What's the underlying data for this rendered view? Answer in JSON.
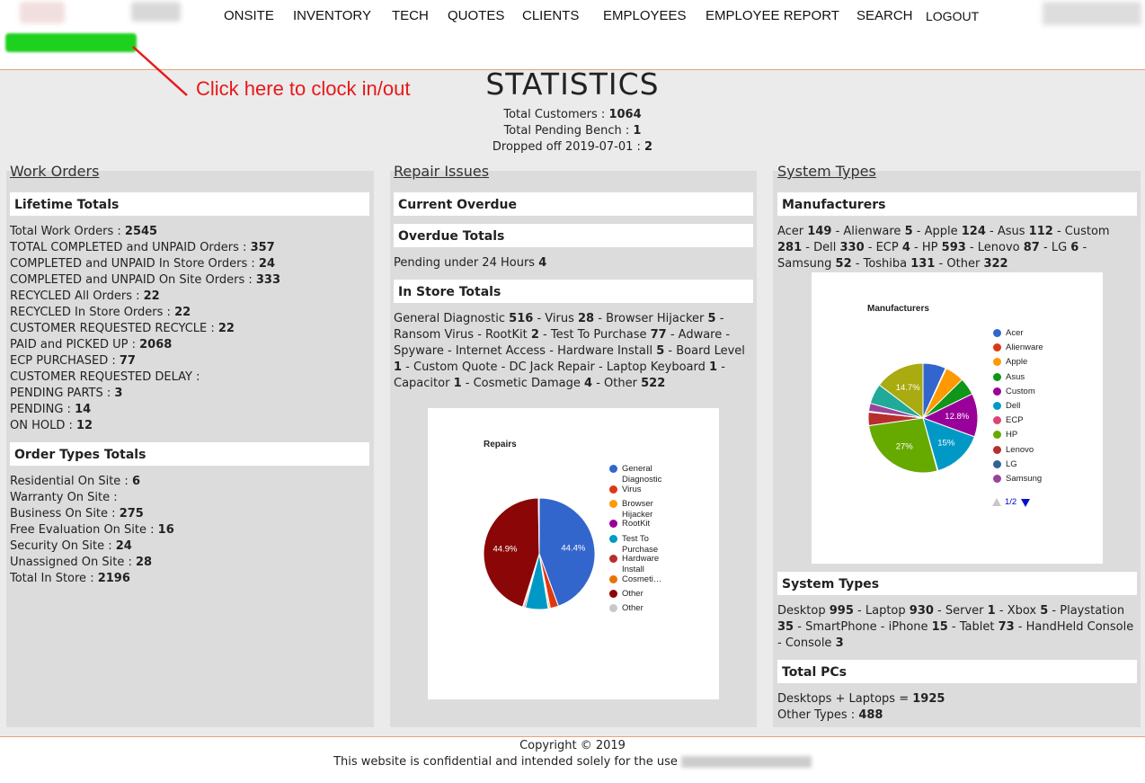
{
  "nav": {
    "items": [
      "ONSITE",
      "INVENTORY",
      "TECH",
      "QUOTES",
      "CLIENTS",
      "EMPLOYEES",
      "EMPLOYEE REPORT",
      "SEARCH",
      "LOGOUT"
    ]
  },
  "annotation": {
    "text": "Click here to clock in/out",
    "color": "#e8181b"
  },
  "stats": {
    "title": "STATISTICS",
    "total_customers_label": "Total Customers :",
    "total_customers": "1064",
    "pending_bench_label": "Total Pending Bench :",
    "pending_bench": "1",
    "dropped_off_label": "Dropped off 2019-07-01 :",
    "dropped_off": "2"
  },
  "work_orders": {
    "title": "Work Orders",
    "lifetime_title": "Lifetime Totals",
    "lifetime": [
      {
        "label": "Total Work Orders :",
        "value": "2545"
      },
      {
        "label": "TOTAL COMPLETED and UNPAID Orders :",
        "value": "357"
      },
      {
        "label": "COMPLETED and UNPAID In Store Orders :",
        "value": "24"
      },
      {
        "label": "COMPLETED and UNPAID On Site Orders :",
        "value": "333"
      },
      {
        "label": "RECYCLED All Orders :",
        "value": "22"
      },
      {
        "label": "RECYCLED In Store Orders :",
        "value": "22"
      },
      {
        "label": "CUSTOMER REQUESTED RECYCLE :",
        "value": "22"
      },
      {
        "label": "PAID and PICKED UP :",
        "value": "2068"
      },
      {
        "label": "ECP PURCHASED :",
        "value": "77"
      },
      {
        "label": "CUSTOMER REQUESTED DELAY :",
        "value": ""
      },
      {
        "label": "PENDING PARTS :",
        "value": "3"
      },
      {
        "label": "PENDING :",
        "value": "14"
      },
      {
        "label": "ON HOLD :",
        "value": "12"
      }
    ],
    "order_types_title": "Order Types Totals",
    "order_types": [
      {
        "label": "Residential On Site :",
        "value": "6"
      },
      {
        "label": "Warranty On Site :",
        "value": ""
      },
      {
        "label": "Business On Site :",
        "value": "275"
      },
      {
        "label": "Free Evaluation On Site :",
        "value": "16"
      },
      {
        "label": "Security On Site :",
        "value": "24"
      },
      {
        "label": "Unassigned On Site :",
        "value": "28"
      },
      {
        "label": "Total In Store :",
        "value": "2196"
      }
    ]
  },
  "repair_issues": {
    "title": "Repair Issues",
    "current_overdue_title": "Current Overdue",
    "overdue_totals_title": "Overdue Totals",
    "overdue_line_label": "Pending under 24 Hours",
    "overdue_line_value": "4",
    "in_store_title": "In Store Totals",
    "in_store_items": [
      {
        "label": "General Diagnostic",
        "value": "516"
      },
      {
        "label": "Virus",
        "value": "28"
      },
      {
        "label": "Browser Hijacker",
        "value": "5"
      },
      {
        "label": "Ransom Virus",
        "value": ""
      },
      {
        "label": "RootKit",
        "value": "2"
      },
      {
        "label": "Test To Purchase",
        "value": "77"
      },
      {
        "label": "Adware",
        "value": ""
      },
      {
        "label": "Spyware",
        "value": ""
      },
      {
        "label": "Internet Access",
        "value": ""
      },
      {
        "label": "Hardware Install",
        "value": "5"
      },
      {
        "label": "Board Level",
        "value": "1"
      },
      {
        "label": "Custom Quote",
        "value": ""
      },
      {
        "label": "DC Jack Repair",
        "value": ""
      },
      {
        "label": "Laptop Keyboard",
        "value": "1"
      },
      {
        "label": "Capacitor",
        "value": "1"
      },
      {
        "label": "Cosmetic Damage",
        "value": "4"
      },
      {
        "label": "Other",
        "value": "522"
      }
    ]
  },
  "system_types": {
    "title": "System Types",
    "manufacturers_title": "Manufacturers",
    "manufacturers": [
      {
        "label": "Acer",
        "value": "149"
      },
      {
        "label": "Alienware",
        "value": "5"
      },
      {
        "label": "Apple",
        "value": "124"
      },
      {
        "label": "Asus",
        "value": "112"
      },
      {
        "label": "Custom",
        "value": "281"
      },
      {
        "label": "Dell",
        "value": "330"
      },
      {
        "label": "ECP",
        "value": "4"
      },
      {
        "label": "HP",
        "value": "593"
      },
      {
        "label": "Lenovo",
        "value": "87"
      },
      {
        "label": "LG",
        "value": "6"
      },
      {
        "label": "Samsung",
        "value": "52"
      },
      {
        "label": "Toshiba",
        "value": "131"
      },
      {
        "label": "Other",
        "value": "322"
      }
    ],
    "system_types_title": "System Types",
    "systems": [
      {
        "label": "Desktop",
        "value": "995"
      },
      {
        "label": "Laptop",
        "value": "930"
      },
      {
        "label": "Server",
        "value": "1"
      },
      {
        "label": "Xbox",
        "value": "5"
      },
      {
        "label": "Playstation",
        "value": "35"
      },
      {
        "label": "SmartPhone",
        "value": ""
      },
      {
        "label": "iPhone",
        "value": "15"
      },
      {
        "label": "Tablet",
        "value": "73"
      },
      {
        "label": "HandHeld Console",
        "value": ""
      },
      {
        "label": "Console",
        "value": "3"
      }
    ],
    "total_pcs_title": "Total PCs",
    "desktops_laptops_label": "Desktops + Laptops =",
    "desktops_laptops": "1925",
    "other_types_label": "Other Types :",
    "other_types": "488"
  },
  "chart_data": [
    {
      "type": "pie",
      "title": "Repairs",
      "categories": [
        "General Diagnostic",
        "Virus",
        "Browser Hijacker",
        "RootKit",
        "Test To Purchase",
        "Hardware Install",
        "Cosmeti…",
        "Other",
        "Other"
      ],
      "values": [
        516,
        28,
        5,
        2,
        77,
        5,
        4,
        522,
        3
      ],
      "slice_labels": [
        "44.4%",
        "",
        "",
        "",
        "",
        "",
        "",
        "44.9%",
        ""
      ],
      "colors": [
        "#3366cc",
        "#dc3912",
        "#ff9900",
        "#990099",
        "#0099c6",
        "#b82e2e",
        "#e67300",
        "#8b0707",
        "#c8c8c8"
      ],
      "legend_position": "right"
    },
    {
      "type": "pie",
      "title": "Manufacturers",
      "categories": [
        "Acer",
        "Alienware",
        "Apple",
        "Asus",
        "Custom",
        "Dell",
        "ECP",
        "HP",
        "Lenovo",
        "LG",
        "Samsung",
        "Toshiba",
        "Other"
      ],
      "values": [
        149,
        5,
        124,
        112,
        281,
        330,
        4,
        593,
        87,
        6,
        52,
        131,
        322
      ],
      "slice_labels": [
        "",
        "",
        "",
        "",
        "12.8%",
        "15%",
        "",
        "27%",
        "",
        "",
        "",
        "",
        "14.7%"
      ],
      "colors": [
        "#3366cc",
        "#dc3912",
        "#ff9900",
        "#109618",
        "#990099",
        "#0099c6",
        "#dd4477",
        "#66aa00",
        "#b82e2e",
        "#316395",
        "#994499",
        "#22aa99",
        "#aaaa11"
      ],
      "legend_visible": [
        "Acer",
        "Alienware",
        "Apple",
        "Asus",
        "Custom",
        "Dell",
        "ECP",
        "HP",
        "Lenovo",
        "LG",
        "Samsung"
      ],
      "legend_page": "1/2",
      "legend_position": "right"
    }
  ],
  "footer": {
    "copyright": "Copyright © 2019",
    "notice": "This website is confidential and intended solely for the use"
  }
}
